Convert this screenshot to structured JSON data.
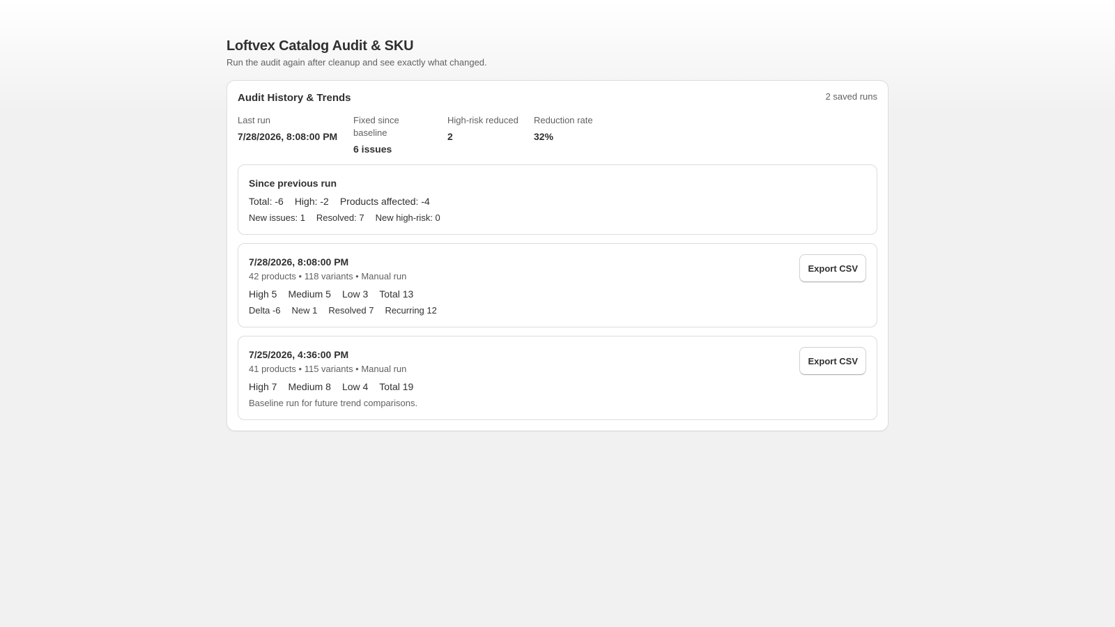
{
  "page": {
    "title": "Loftvex Catalog Audit & SKU",
    "subtitle": "Run the audit again after cleanup and see exactly what changed."
  },
  "history": {
    "title": "Audit History & Trends",
    "saved_runs": "2 saved runs",
    "stats": [
      {
        "label": "Last run",
        "value": "7/28/2026, 8:08:00 PM"
      },
      {
        "label": "Fixed since baseline",
        "value": "6 issues"
      },
      {
        "label": "High-risk reduced",
        "value": "2"
      },
      {
        "label": "Reduction rate",
        "value": "32%"
      }
    ]
  },
  "since_previous": {
    "title": "Since previous run",
    "total": "Total: -6",
    "high": "High: -2",
    "products_affected": "Products affected: -4",
    "new_issues": "New issues: 1",
    "resolved": "Resolved: 7",
    "new_high_risk": "New high-risk: 0"
  },
  "runs": [
    {
      "date": "7/28/2026, 8:08:00 PM",
      "meta": "42 products • 118 variants • Manual run",
      "high": "High 5",
      "medium": "Medium 5",
      "low": "Low 3",
      "total": "Total 13",
      "delta": "Delta -6",
      "new": "New 1",
      "resolved": "Resolved 7",
      "recurring": "Recurring 12",
      "export_label": "Export CSV"
    },
    {
      "date": "7/25/2026, 4:36:00 PM",
      "meta": "41 products • 115 variants • Manual run",
      "high": "High 7",
      "medium": "Medium 8",
      "low": "Low 4",
      "total": "Total 19",
      "note": "Baseline run for future trend comparisons.",
      "export_label": "Export CSV"
    }
  ]
}
